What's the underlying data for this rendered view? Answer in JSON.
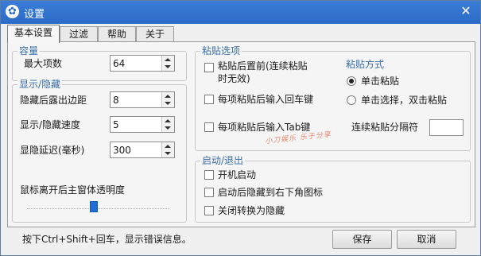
{
  "window": {
    "title": "设置",
    "close_glyph": "✕",
    "icon": "gear-icon",
    "icon_glyph": "✿"
  },
  "tabs": [
    {
      "label": "基本设置",
      "active": true
    },
    {
      "label": "过滤",
      "active": false
    },
    {
      "label": "帮助",
      "active": false
    },
    {
      "label": "关于",
      "active": false
    }
  ],
  "capacity": {
    "title": "容量",
    "max_items_label": "最大项数",
    "max_items_value": "64"
  },
  "display": {
    "title": "显示/隐藏",
    "hide_margin_label": "隐藏后露出边距",
    "hide_margin_value": "8",
    "speed_label": "显示/隐藏速度",
    "speed_value": "5",
    "delay_label": "显隐延迟(毫秒)",
    "delay_value": "300",
    "opacity_label": "鼠标离开后主窗体透明度",
    "opacity_level_percent": 47
  },
  "paste": {
    "title": "粘贴选项",
    "opt1_line1": "粘贴后置前(连续粘贴",
    "opt1_line2": "时无效)",
    "opt2": "每项粘贴后输入回车键",
    "opt3": "每项粘贴后输入Tab键",
    "mode_title": "粘贴方式",
    "mode_single": "单击粘贴",
    "mode_double": "单击选择，双击粘贴",
    "separator_label": "连续粘贴分隔符",
    "separator_value": ""
  },
  "startup": {
    "title": "启动/退出",
    "opt1": "开机启动",
    "opt2": "启动后隐藏到右下角图标",
    "opt3": "关闭转换为隐藏"
  },
  "watermark": {
    "text": "小刀娱乐  乐于分享"
  },
  "status_text": "按下Ctrl+Shift+回车，显示错误信息。",
  "buttons": {
    "save": "保存",
    "cancel": "取消"
  }
}
